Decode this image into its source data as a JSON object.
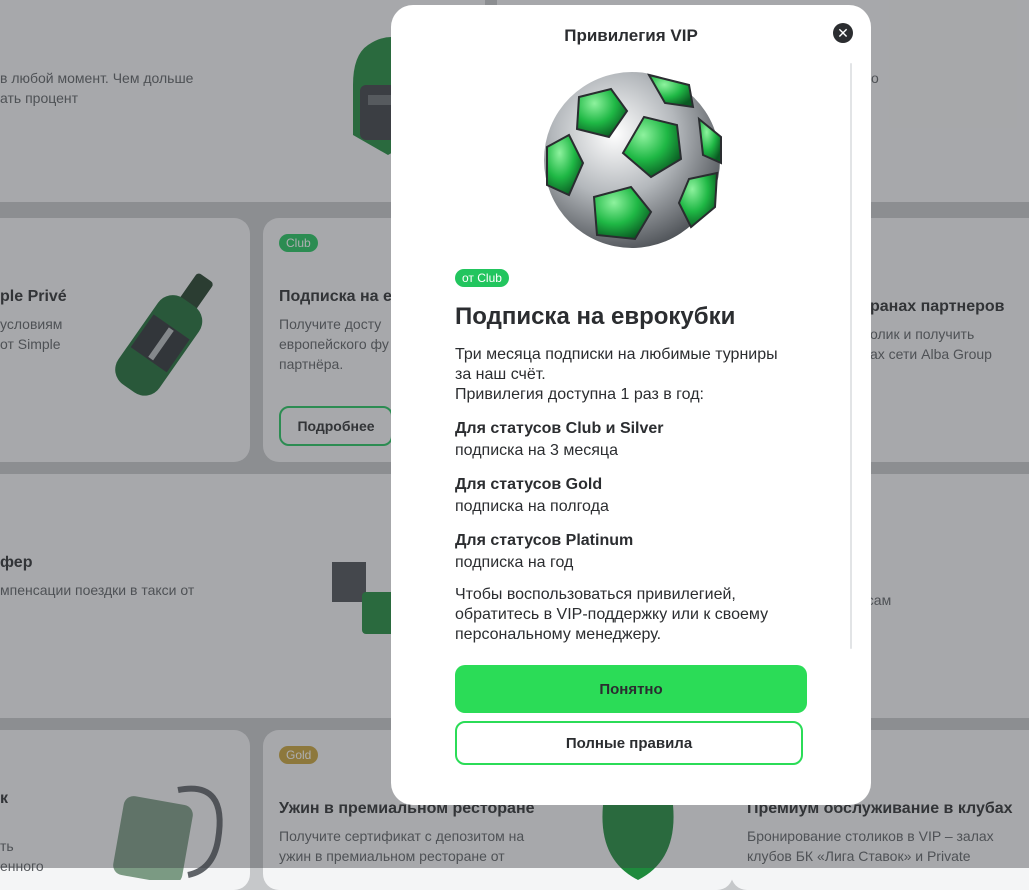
{
  "background": {
    "top_left_text": [
      "в любой момент. Чем дольше",
      "ать процент"
    ],
    "top_right_text": "о",
    "simple_card": {
      "title": "ple Privé",
      "text": [
        "условиям",
        "от Simple"
      ]
    },
    "euro_card": {
      "badge": "Club",
      "title": "Подписка на е",
      "text": [
        "Получите досту",
        "европейского фу",
        "партнёра."
      ],
      "button": "Подробнее"
    },
    "partners_card": {
      "title": "ранах партнеров",
      "text": [
        "олик и получить",
        "ах сети Alba Group"
      ]
    },
    "taxi_card": {
      "title": "фер",
      "text": "мпенсации поездки в такси от"
    },
    "right_mid_text": "осам",
    "ski_card": {
      "title": "к",
      "text": [
        "ть",
        "енного"
      ]
    },
    "restaurant_card": {
      "badge": "Gold",
      "title": "Ужин в премиальном ресторане",
      "text": [
        "Получите сертификат с депозитом на",
        "ужин в премиальном ресторане от"
      ]
    },
    "clubs_card": {
      "title": "Премиум обслуживание в клубах",
      "text": [
        "Бронирование столиков в VIP – залах",
        "клубов БК «Лига Ставок» и Private"
      ]
    }
  },
  "modal": {
    "title": "Привилегия VIP",
    "close_icon": "close-icon",
    "image": "soccer-ball",
    "badge": "от Club",
    "heading": "Подписка на еврокубки",
    "intro": [
      "Три месяца подписки на любимые турниры",
      "за наш счёт.",
      "Привилегия доступна 1 раз в год:"
    ],
    "tiers": [
      {
        "status": "Для статусов Club и Silver",
        "value": "подписка на 3 месяца"
      },
      {
        "status": "Для статусов Gold",
        "value": "подписка на полгода"
      },
      {
        "status": "Для статусов Platinum",
        "value": "подписка на год"
      }
    ],
    "outro": [
      "Чтобы воспользоваться привилегией,",
      "обратитесь в VIP-поддержку или к своему",
      "персональному менеджеру."
    ],
    "primary_button": "Понятно",
    "secondary_button": "Полные правила"
  },
  "colors": {
    "accent": "#2bdc57",
    "badge_club": "#22c55e",
    "badge_gold": "#c8a238",
    "text": "#2b2d30"
  }
}
